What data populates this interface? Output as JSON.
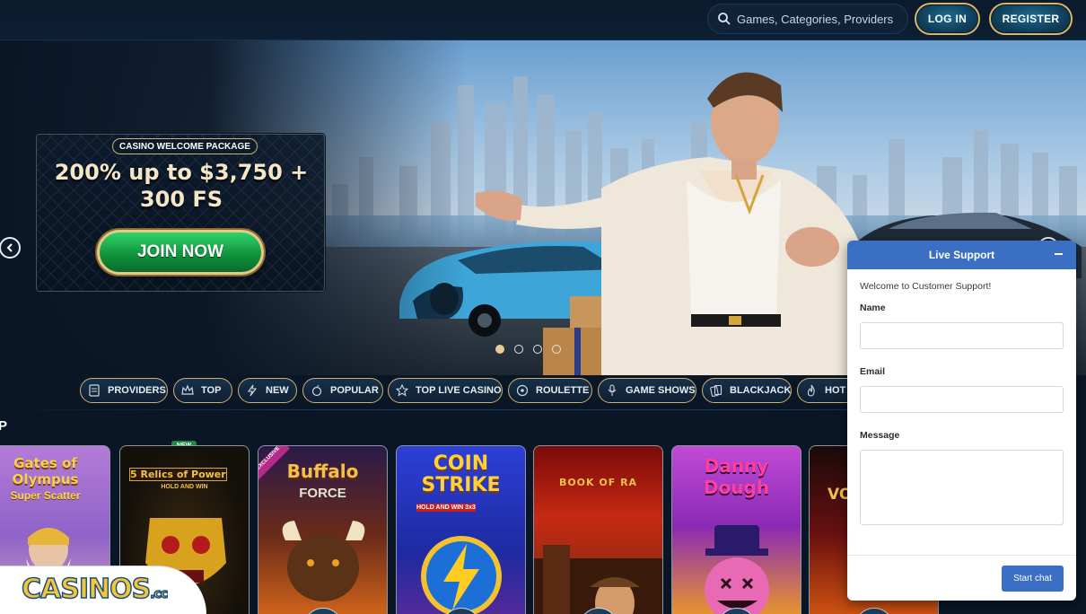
{
  "header": {
    "search_placeholder": "Games, Categories, Providers",
    "login_label": "LOG IN",
    "register_label": "REGISTER"
  },
  "hero": {
    "promo_tag": "CASINO WELCOME PACKAGE",
    "promo_line1": "200% up to $3,750 +",
    "promo_line2": "300 FS",
    "cta_label": "JOIN NOW",
    "slide_count": 4,
    "active_slide": 1
  },
  "categories": [
    {
      "label": "PROVIDERS",
      "icon": "providers-icon"
    },
    {
      "label": "TOP",
      "icon": "crown-icon"
    },
    {
      "label": "NEW",
      "icon": "lightning-icon"
    },
    {
      "label": "POPULAR",
      "icon": "bomb-icon"
    },
    {
      "label": "TOP LIVE CASINO",
      "icon": "star-icon"
    },
    {
      "label": "ROULETTE",
      "icon": "roulette-icon"
    },
    {
      "label": "GAME SHOWS",
      "icon": "microphone-icon"
    },
    {
      "label": "BLACKJACK",
      "icon": "cards-icon"
    },
    {
      "label": "HOT",
      "icon": "fire-icon"
    }
  ],
  "section": {
    "heading_visible": "P"
  },
  "games": [
    {
      "title": "Gates of Olympus",
      "subtitle": "Super Scatter"
    },
    {
      "title": "5 Relics of Power",
      "subtitle": "HOLD AND WIN",
      "badge": "NEW"
    },
    {
      "title": "Buffalo",
      "subtitle": "FORCE",
      "badge": "EXCLUSIVE"
    },
    {
      "title": "COIN STRIKE",
      "subtitle": "HOLD AND WIN 3x3"
    },
    {
      "title": "BOOK OF RA",
      "subtitle": ""
    },
    {
      "title": "Danny Dough",
      "subtitle": ""
    },
    {
      "title": "VO",
      "subtitle": ""
    }
  ],
  "logo": {
    "text": "CASINOS",
    "suffix": ".cc"
  },
  "chat": {
    "title": "Live Support",
    "welcome": "Welcome to Customer Support!",
    "name_label": "Name",
    "email_label": "Email",
    "message_label": "Message",
    "start_label": "Start chat"
  }
}
